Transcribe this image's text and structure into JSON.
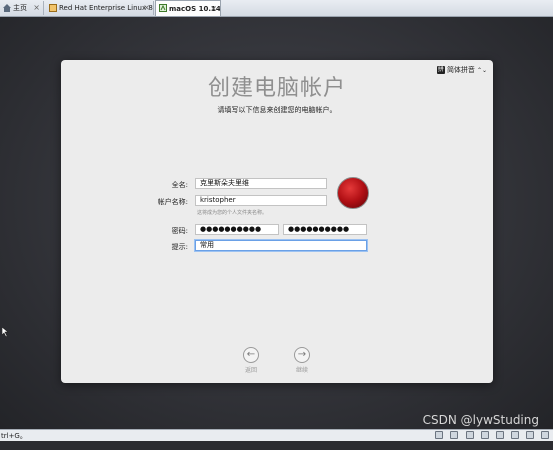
{
  "tabs": [
    {
      "label": "主页",
      "close": "×"
    },
    {
      "label": "Red Hat Enterprise Linux 8 64...",
      "close": "×"
    },
    {
      "label": "macOS 10.14",
      "close": "×"
    }
  ],
  "ime": {
    "label": "简体拼音",
    "badge": "拼",
    "arrows": "⌃⌄"
  },
  "panel": {
    "title": "创建电脑帐户",
    "subtitle": "请填写以下信息来创建您的电脑帐户。"
  },
  "form": {
    "fullname_label": "全名:",
    "fullname_value": "克里斯朵夫里维",
    "account_label": "帐户名称:",
    "account_value": "kristopher",
    "account_hint": "这将成为您的个人文件夹名称。",
    "password_label": "密码:",
    "password_value": "●●●●●●●●●●",
    "verify_value": "●●●●●●●●●●",
    "hint_label": "提示:",
    "hint_value": "常用"
  },
  "nav": {
    "back_label": "返回",
    "continue_label": "继续",
    "back_glyph": "←",
    "continue_glyph": "→"
  },
  "watermark": "CSDN @lywStuding",
  "statusbar": {
    "text": "trl+G。"
  }
}
